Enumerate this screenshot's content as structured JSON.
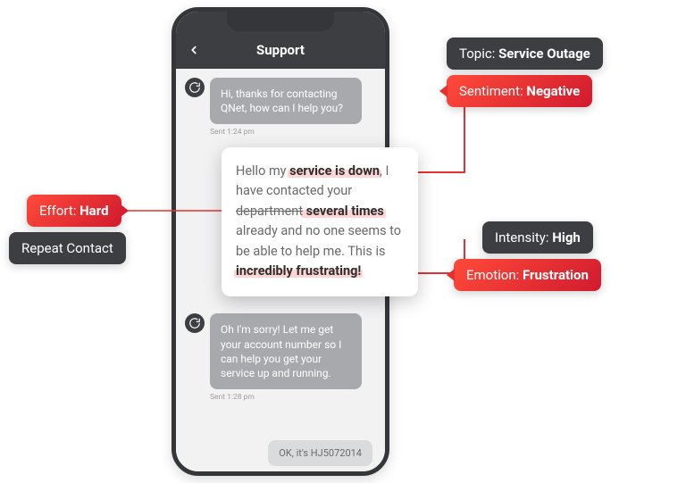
{
  "header": {
    "title": "Support"
  },
  "messages": {
    "agent1": "Hi, thanks for contacting QNet, how can I help you?",
    "agent1_ts": "Sent 1:24 pm",
    "user": {
      "pre": "Hello my ",
      "h1": "service is down",
      "mid1": ", I have contacted your ",
      "struck": "department",
      "h2": " several times",
      "mid2": " already and no one seems to be able to help me. This is ",
      "h3": "incredibly frustrating!"
    },
    "agent2": "Oh I'm sorry! Let me get your account number so I can help you get your service up and running.",
    "agent2_ts": "Sent 1:28 pm",
    "reply_stub": "OK, it's HJ5072014"
  },
  "annotations": {
    "topic": {
      "label": "Topic: ",
      "value": "Service Outage"
    },
    "sentiment": {
      "label": "Sentiment: ",
      "value": "Negative"
    },
    "intensity": {
      "label": "Intensity: ",
      "value": "High"
    },
    "emotion": {
      "label": "Emotion: ",
      "value": "Frustration"
    },
    "effort": {
      "label": "Effort: ",
      "value": "Hard"
    },
    "repeat": {
      "label": "Repeat Contact",
      "value": ""
    }
  }
}
